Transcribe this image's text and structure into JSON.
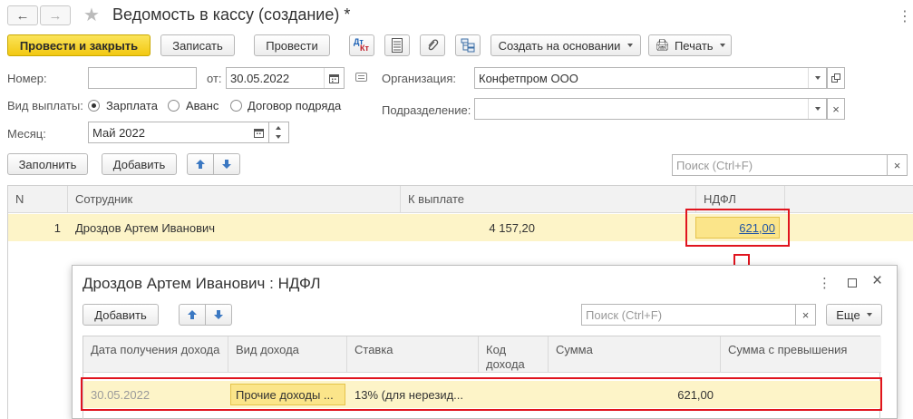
{
  "window": {
    "title": "Ведомость в кассу (создание) *"
  },
  "toolbar": {
    "post_close": "Провести и закрыть",
    "save": "Записать",
    "post": "Провести",
    "dtkt_top": "Дт",
    "dtkt_bottom": "Кт",
    "create_based": "Создать на основании",
    "print": "Печать",
    "more_dots": "⋮"
  },
  "form": {
    "number_label": "Номер:",
    "number_value": "",
    "date_label": "от:",
    "date_value": "30.05.2022",
    "org_label": "Организация:",
    "org_value": "Конфетпром ООО",
    "payment_type_label": "Вид выплаты:",
    "payment_options": [
      "Зарплата",
      "Аванс",
      "Договор подряда"
    ],
    "payment_selected": "Зарплата",
    "division_label": "Подразделение:",
    "division_value": "",
    "month_label": "Месяц:",
    "month_value": "Май 2022"
  },
  "table_toolbar": {
    "fill": "Заполнить",
    "add": "Добавить",
    "search_placeholder": "Поиск (Ctrl+F)",
    "clear": "×"
  },
  "table": {
    "columns": [
      "N",
      "Сотрудник",
      "К выплате",
      "НДФЛ"
    ],
    "rows": [
      {
        "n": "1",
        "employee": "Дроздов Артем Иванович",
        "pay": "4 157,20",
        "ndfl": "621,00"
      }
    ]
  },
  "dialog": {
    "title": "Дроздов Артем Иванович : НДФЛ",
    "add": "Добавить",
    "search_placeholder": "Поиск (Ctrl+F)",
    "clear": "×",
    "more": "Еще",
    "columns": [
      "Дата получения дохода",
      "Вид дохода",
      "Ставка",
      "Код дохода",
      "Сумма",
      "Сумма с превышения"
    ],
    "rows": [
      {
        "date": "30.05.2022",
        "income_type": "Прочие доходы ...",
        "rate": "13% (для нерезид...",
        "code": "",
        "sum": "621,00",
        "excess": ""
      }
    ]
  },
  "colors": {
    "accent_yellow": "#f2c811",
    "row_highlight": "#fdf4c8",
    "annotation_red": "#e0141e",
    "link_blue": "#2255a4"
  }
}
